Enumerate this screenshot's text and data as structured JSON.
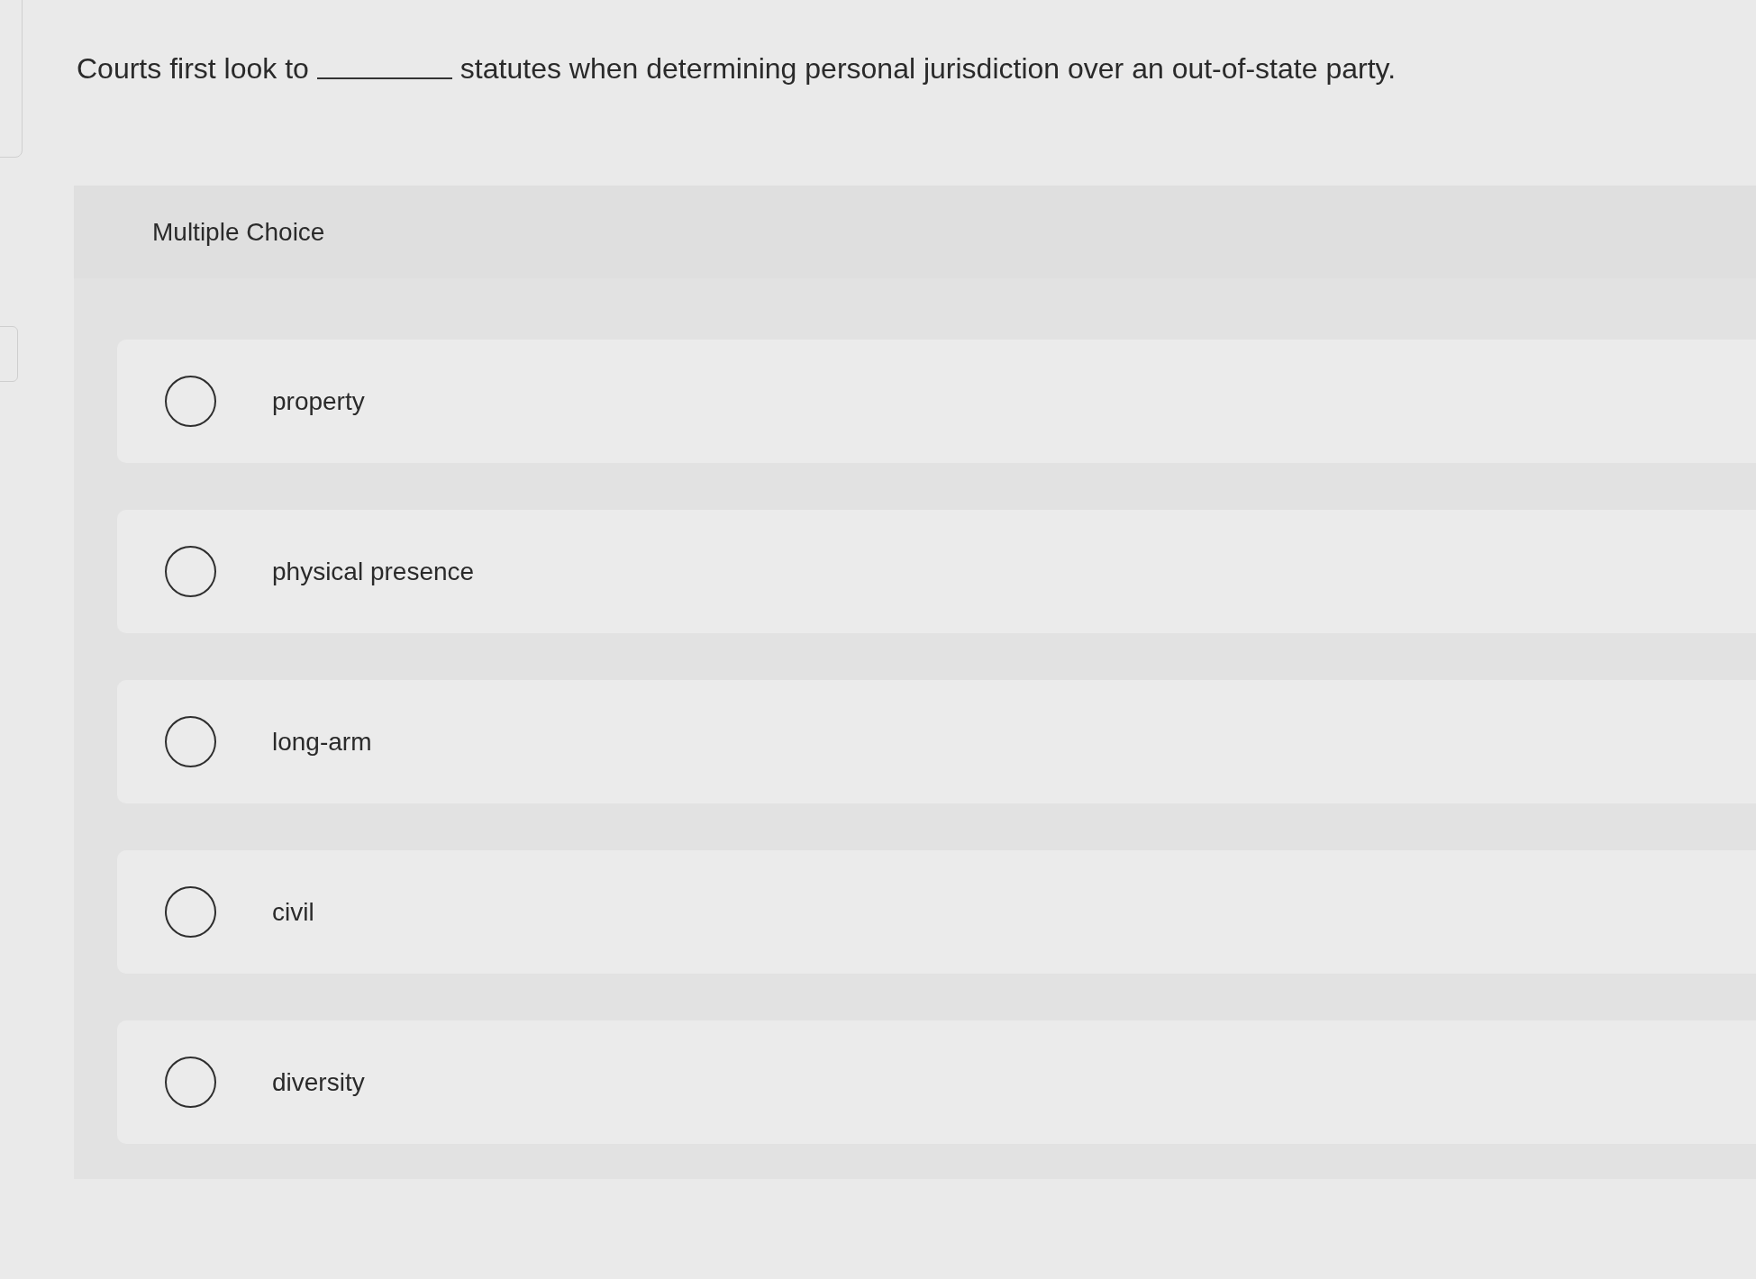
{
  "question": {
    "before": "Courts first look to",
    "after": "statutes when determining personal jurisdiction over an out-of-state party."
  },
  "panel": {
    "title": "Multiple Choice"
  },
  "options": [
    {
      "label": "property",
      "selected": false
    },
    {
      "label": "physical presence",
      "selected": false
    },
    {
      "label": "long-arm",
      "selected": false
    },
    {
      "label": "civil",
      "selected": false
    },
    {
      "label": "diversity",
      "selected": false
    }
  ]
}
